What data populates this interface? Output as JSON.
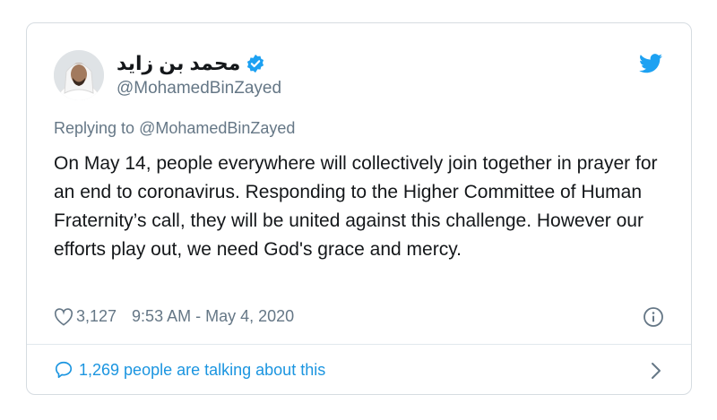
{
  "tweet": {
    "author_name": "محمد بن زايد",
    "handle": "@MohamedBinZayed",
    "replying_prefix": "Replying to ",
    "replying_handle": "@MohamedBinZayed",
    "text": "On May 14, people everywhere will collectively join together in prayer for an end to coronavirus. Responding to the Higher Committee of Human Fraternity’s call, they will be united against this challenge. However our efforts play out, we need God's grace and mercy.",
    "likes": "3,127",
    "timestamp": "9:53 AM - May 4, 2020",
    "talking": "1,269 people are talking about this"
  },
  "icons": {
    "verified": "verified-badge-icon",
    "bird": "twitter-bird-icon",
    "heart": "heart-icon",
    "info": "info-icon",
    "bubble": "speech-bubble-icon",
    "chevron": "chevron-right-icon"
  },
  "colors": {
    "brand_blue": "#1da1f2",
    "link_blue": "#1b95e0",
    "text_dark": "#14171a",
    "text_gray": "#657786",
    "border": "#d6dce1"
  }
}
